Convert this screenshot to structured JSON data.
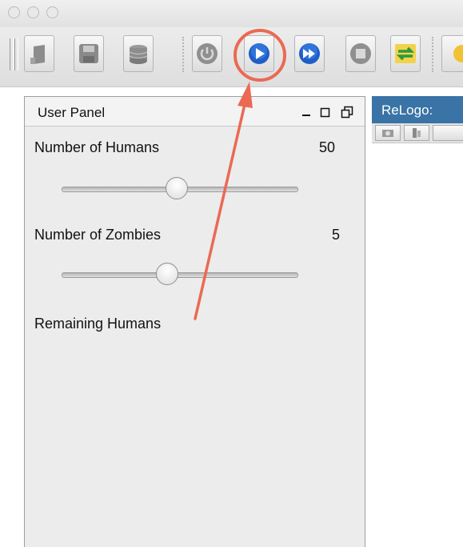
{
  "toolbar": {
    "buttons": [
      {
        "name": "load-icon"
      },
      {
        "name": "save-icon"
      },
      {
        "name": "database-icon"
      },
      {
        "name": "power-icon"
      },
      {
        "name": "play-icon"
      },
      {
        "name": "fast-forward-icon"
      },
      {
        "name": "stop-icon"
      },
      {
        "name": "reset-icon"
      }
    ]
  },
  "user_panel": {
    "title": "User Panel",
    "controls": [
      {
        "label": "Number of Humans",
        "value": "50",
        "slider_fraction": 0.49
      },
      {
        "label": "Number of Zombies",
        "value": "5",
        "slider_fraction": 0.45
      }
    ],
    "remaining_label": "Remaining Humans"
  },
  "relogo": {
    "tab_label": "ReLogo:"
  },
  "colors": {
    "accent_tab": "#3a73a5",
    "annotation": "#ea6a54",
    "play_blue": "#1d5ec7"
  }
}
